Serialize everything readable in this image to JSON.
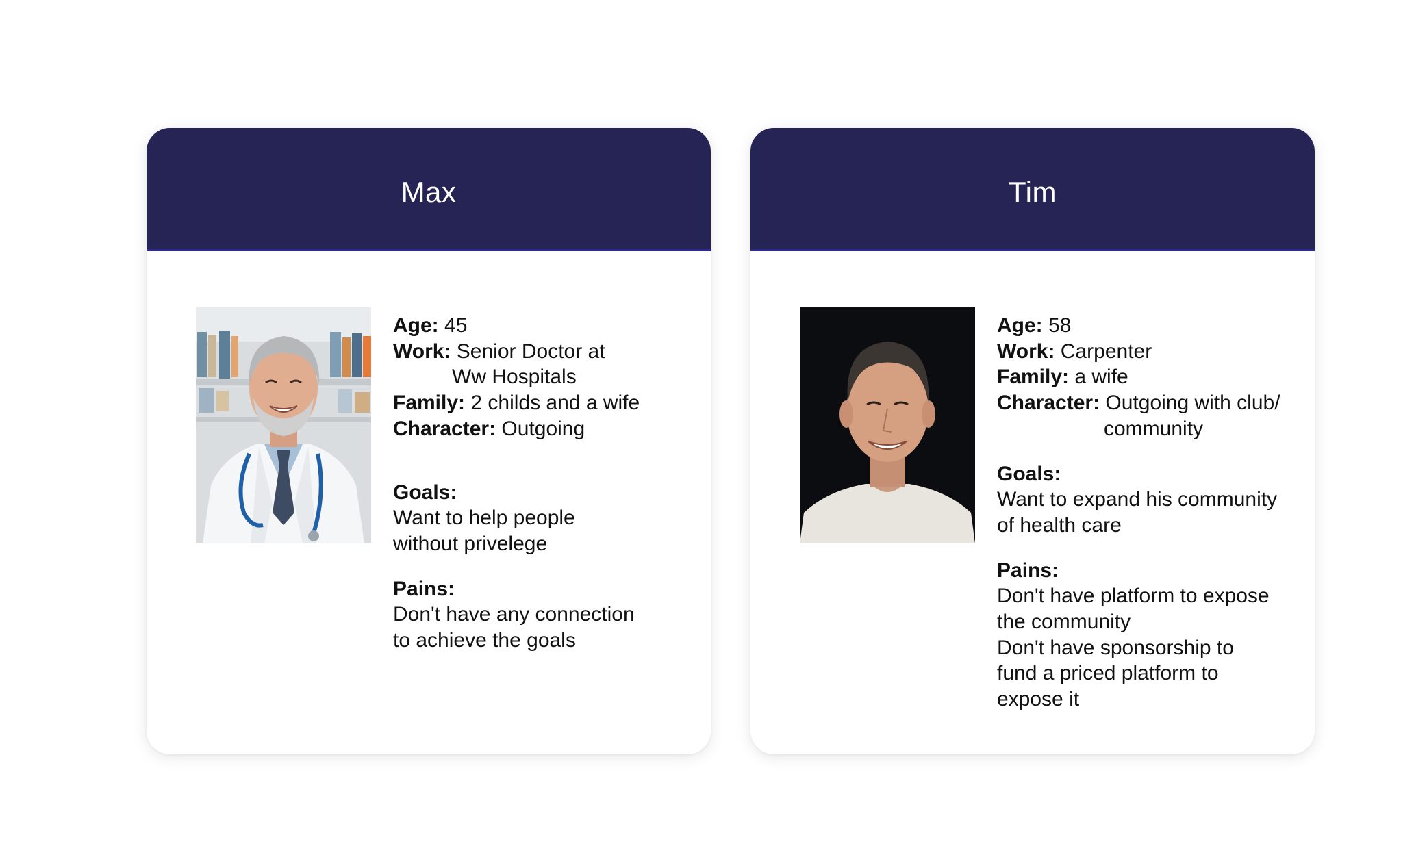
{
  "personas": [
    {
      "name": "Max",
      "portrait": "doctor-portrait",
      "age_label": "Age:",
      "age_value": "45",
      "work_label": "Work:",
      "work_value_line1": "Senior Doctor at",
      "work_value_line2": "Ww Hospitals",
      "family_label": "Family:",
      "family_value": "2 childs and a wife",
      "character_label": "Character:",
      "character_value_line1": "Outgoing",
      "goals_label": "Goals:",
      "goals_lines": [
        "Want to help people",
        "without privelege"
      ],
      "pains_label": "Pains:",
      "pains_lines": [
        "Don't have any connection",
        "to achieve the goals"
      ]
    },
    {
      "name": "Tim",
      "portrait": "man-portrait",
      "age_label": "Age:",
      "age_value": "58",
      "work_label": "Work:",
      "work_value_line1": "Carpenter",
      "family_label": "Family:",
      "family_value": "a wife",
      "character_label": "Character:",
      "character_value_line1": "Outgoing with club/",
      "character_value_line2": "community",
      "goals_label": "Goals:",
      "goals_lines": [
        "Want to expand his community",
        "of health care"
      ],
      "pains_label": "Pains:",
      "pains_lines": [
        "Don't have platform to expose",
        "the community",
        "Don't have sponsorship to",
        "fund a priced platform to",
        "expose it"
      ]
    }
  ],
  "colors": {
    "header_bg": "#252455",
    "header_text": "#ffffff",
    "card_bg": "#ffffff",
    "body_text": "#111111"
  }
}
